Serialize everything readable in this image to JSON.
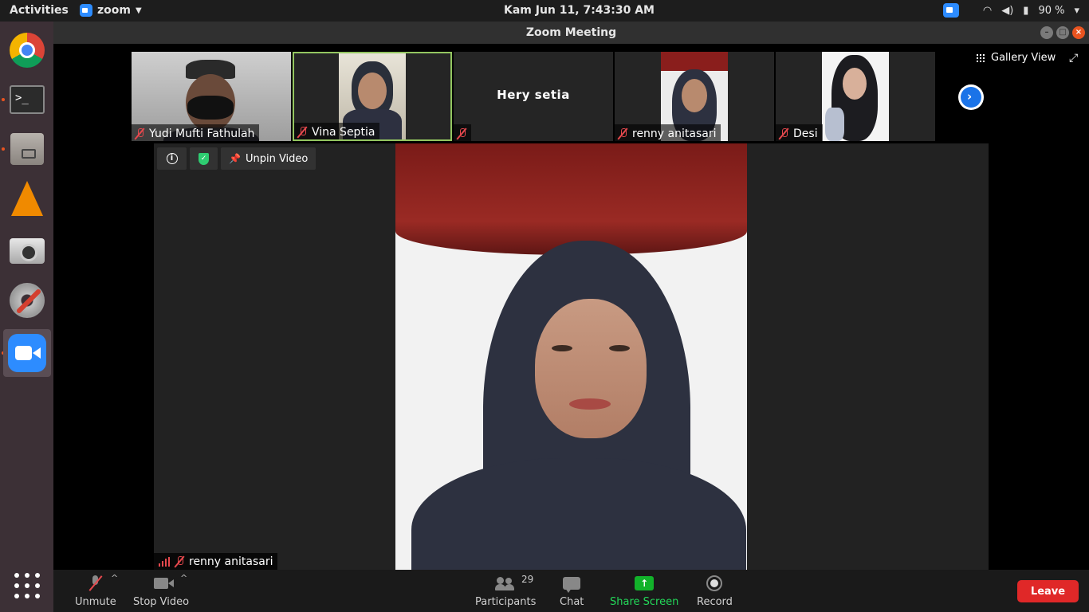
{
  "topbar": {
    "activities": "Activities",
    "app_name": "zoom",
    "clock": "Kam Jun 11,  7:43:30 AM",
    "battery": "90 %"
  },
  "dock": {
    "items": [
      "chrome-icon",
      "terminal-icon",
      "files-icon",
      "vlc-icon",
      "camera-icon",
      "settings-icon",
      "zoom-icon",
      "show-apps-icon"
    ]
  },
  "window": {
    "title": "Zoom Meeting"
  },
  "gallery": {
    "view_label": "Gallery View",
    "thumbnails": [
      {
        "name": "Yudi Mufti Fathulah",
        "video": true
      },
      {
        "name": "Vina Septia",
        "video": true,
        "selected": true
      },
      {
        "name": "Hery setia",
        "video": false
      },
      {
        "name": "renny anitasari",
        "video": true
      },
      {
        "name": "Desi",
        "video": true
      }
    ]
  },
  "stage": {
    "unpin_label": "Unpin Video",
    "speaker_name": "renny anitasari"
  },
  "toolbar": {
    "unmute": "Unmute",
    "stop_video": "Stop Video",
    "participants": "Participants",
    "participants_count": "29",
    "chat": "Chat",
    "share_screen": "Share Screen",
    "record": "Record",
    "leave": "Leave"
  },
  "colors": {
    "accent_blue": "#2d8cff",
    "share_green": "#12b22a",
    "leave_red": "#e02828",
    "selected_border": "#93c560",
    "share_label": "#23d959"
  }
}
